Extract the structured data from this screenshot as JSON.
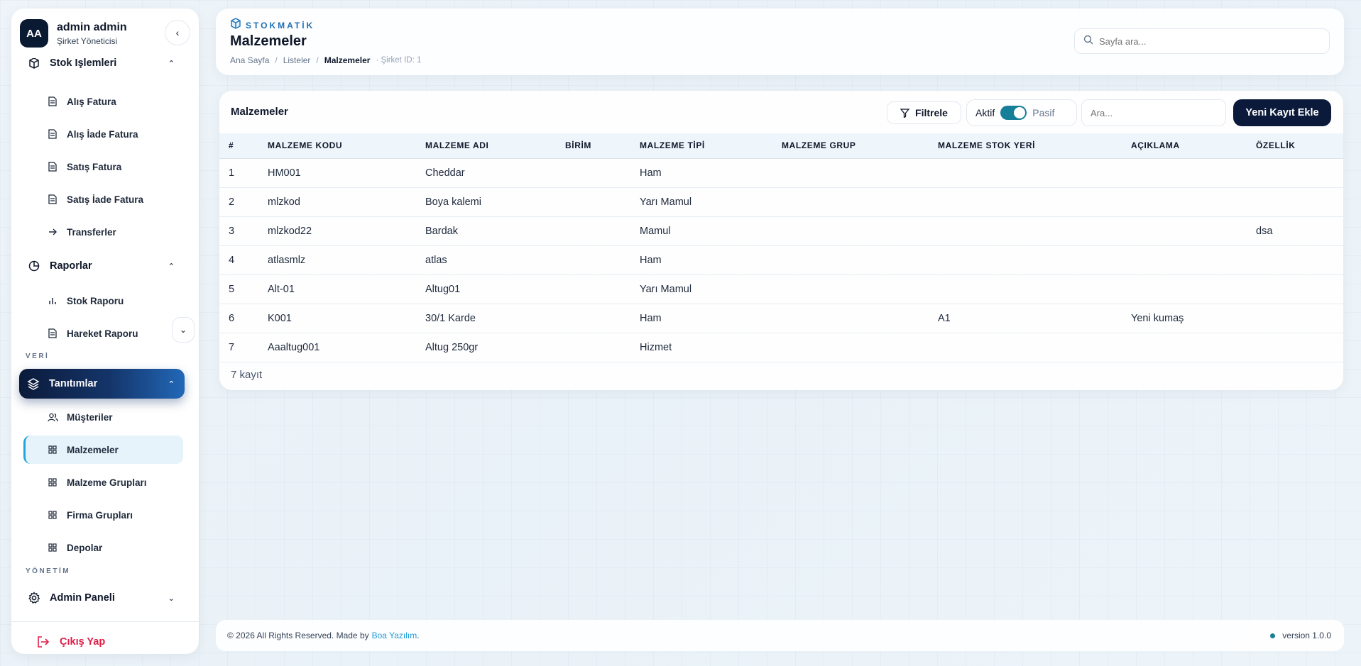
{
  "profile": {
    "initials": "AA",
    "name": "admin admin",
    "role": "Şirket Yöneticisi"
  },
  "sidebar": {
    "stok_group": {
      "label": "Stok İşlemleri"
    },
    "stok_items": [
      {
        "label": "Alış Fatura"
      },
      {
        "label": "Alış İade Fatura"
      },
      {
        "label": "Satış Fatura"
      },
      {
        "label": "Satış İade Fatura"
      },
      {
        "label": "Transferler"
      }
    ],
    "raporlar_group": {
      "label": "Raporlar"
    },
    "rapor_items": [
      {
        "label": "Stok Raporu"
      },
      {
        "label": "Hareket Raporu"
      }
    ],
    "section_veri": "VERİ",
    "tanimlar_group": {
      "label": "Tanıtımlar"
    },
    "tanim_items": [
      {
        "label": "Müşteriler"
      },
      {
        "label": "Malzemeler"
      },
      {
        "label": "Malzeme Grupları"
      },
      {
        "label": "Firma Grupları"
      },
      {
        "label": "Depolar"
      }
    ],
    "section_yonetim": "YÖNETİM",
    "admin_group": {
      "label": "Admin Paneli"
    },
    "logout": "Çıkış Yap"
  },
  "header": {
    "brand": "STOKMATİK",
    "title": "Malzemeler",
    "breadcrumb": [
      "Ana Sayfa",
      "Listeler",
      "Malzemeler"
    ],
    "company": "· Şirket ID: 1",
    "search_placeholder": "Sayfa ara..."
  },
  "table_card": {
    "title": "Malzemeler",
    "filter_label": "Filtrele",
    "toggle_on": "Aktif",
    "toggle_off": "Pasif",
    "search_placeholder": "Ara...",
    "new_button": "Yeni Kayıt Ekle",
    "columns": [
      "#",
      "MALZEME KODU",
      "MALZEME ADI",
      "BİRİM",
      "MALZEME TİPİ",
      "MALZEME GRUP",
      "MALZEME STOK YERİ",
      "AÇIKLAMA",
      "ÖZELLİK"
    ],
    "rows": [
      [
        "1",
        "HM001",
        "Cheddar",
        "",
        "Ham",
        "",
        "",
        "",
        ""
      ],
      [
        "2",
        "mlzkod",
        "Boya kalemi",
        "",
        "Yarı Mamul",
        "",
        "",
        "",
        ""
      ],
      [
        "3",
        "mlzkod22",
        "Bardak",
        "",
        "Mamul",
        "",
        "",
        "",
        "dsa"
      ],
      [
        "4",
        "atlasmlz",
        "atlas",
        "",
        "Ham",
        "",
        "",
        "",
        ""
      ],
      [
        "5",
        "Alt-01",
        "Altug01",
        "",
        "Yarı Mamul",
        "",
        "",
        "",
        ""
      ],
      [
        "6",
        "K001",
        "30/1 Karde",
        "",
        "Ham",
        "",
        "A1",
        "Yeni kumaş",
        ""
      ],
      [
        "7",
        "Aaaltug001",
        "Altug 250gr",
        "",
        "Hizmet",
        "",
        "",
        "",
        ""
      ]
    ],
    "record_count": "7 kayıt"
  },
  "footer": {
    "copyright": "© 2026 All Rights Reserved. Made by",
    "company_link": "Boa Yazılım",
    "period": ".",
    "version": "version 1.0.0"
  }
}
